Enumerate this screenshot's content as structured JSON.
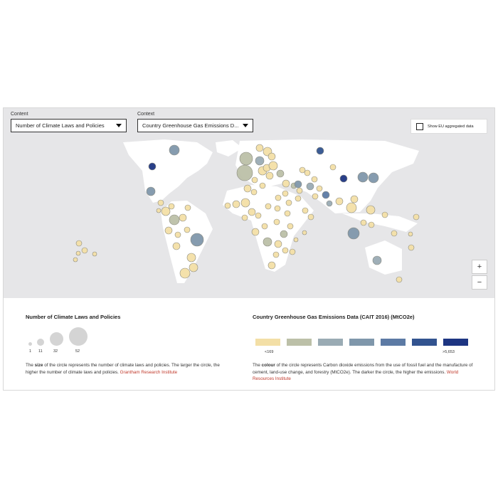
{
  "controls": {
    "content_label": "Content",
    "content_value": "Number of Climate Laws and Policies",
    "context_label": "Context",
    "context_value": "Country Greenhouse Gas Emissions D...",
    "eu_label": "Show EU aggregated data",
    "zoom_in": "+",
    "zoom_out": "−"
  },
  "size_legend": {
    "title": "Number of Climate Laws and Policies",
    "values": [
      "1",
      "11",
      "32",
      "52"
    ],
    "desc_prefix": "The ",
    "desc_bold": "size",
    "desc_rest": " of the circle represents the number of climate laws and policies. The larger the circle, the higher the number of climate laws and policies.",
    "source": "Grantham Research Institute"
  },
  "color_legend": {
    "title": "Country Greenhouse Gas Emissions Data (CAIT 2016) (MtCO2e)",
    "min_label": "<169",
    "max_label": ">5,653",
    "desc_prefix": "The ",
    "desc_bold": "colour",
    "desc_rest": " of the circle represents Carbon dioxide emissions from the use of fossil fuel and the manufacture of cement, land-use change, and forestry (MtCO2e). The darker the circle, the higher the emissions.",
    "source": "World Resources Institute"
  },
  "colors": {
    "scale": [
      "#f3dfa6",
      "#bcc0a8",
      "#9aabb4",
      "#7f97ab",
      "#5c7aa4",
      "#32538f",
      "#1d3582"
    ],
    "land": "#ffffff",
    "ocean": "#e6e6e8"
  },
  "bubbles": [
    [
      244,
      211,
      7,
      3
    ],
    [
      213,
      234,
      5,
      6
    ],
    [
      211,
      269,
      6,
      3
    ],
    [
      225,
      285,
      4,
      0
    ],
    [
      232,
      297,
      6,
      0
    ],
    [
      244,
      309,
      7,
      1
    ],
    [
      236,
      324,
      5,
      0
    ],
    [
      256,
      306,
      5,
      0
    ],
    [
      263,
      292,
      4,
      0
    ],
    [
      276,
      337,
      9,
      3
    ],
    [
      268,
      362,
      6,
      0
    ],
    [
      259,
      384,
      7,
      0
    ],
    [
      271,
      376,
      6,
      0
    ],
    [
      247,
      346,
      5,
      0
    ],
    [
      249,
      330,
      4,
      0
    ],
    [
      262,
      323,
      4,
      0
    ],
    [
      240,
      290,
      4,
      0
    ],
    [
      222,
      296,
      3,
      0
    ],
    [
      110,
      342,
      4,
      0
    ],
    [
      118,
      352,
      4,
      0
    ],
    [
      109,
      356,
      3,
      0
    ],
    [
      132,
      357,
      3,
      0
    ],
    [
      105,
      365,
      3,
      0
    ],
    [
      364,
      208,
      5,
      0
    ],
    [
      375,
      213,
      6,
      0
    ],
    [
      381,
      220,
      5,
      0
    ],
    [
      345,
      223,
      9,
      1
    ],
    [
      343,
      243,
      11,
      1
    ],
    [
      364,
      226,
      6,
      2
    ],
    [
      368,
      240,
      6,
      0
    ],
    [
      374,
      236,
      5,
      0
    ],
    [
      383,
      233,
      6,
      0
    ],
    [
      378,
      247,
      5,
      0
    ],
    [
      357,
      253,
      4,
      0
    ],
    [
      347,
      265,
      5,
      0
    ],
    [
      356,
      270,
      4,
      0
    ],
    [
      368,
      261,
      4,
      0
    ],
    [
      393,
      244,
      5,
      1
    ],
    [
      401,
      258,
      5,
      0
    ],
    [
      412,
      261,
      4,
      1
    ],
    [
      420,
      268,
      4,
      0
    ],
    [
      424,
      239,
      4,
      0
    ],
    [
      431,
      243,
      4,
      0
    ],
    [
      435,
      262,
      5,
      2
    ],
    [
      442,
      276,
      4,
      0
    ],
    [
      448,
      265,
      4,
      0
    ],
    [
      441,
      252,
      4,
      0
    ],
    [
      400,
      272,
      4,
      0
    ],
    [
      390,
      278,
      4,
      0
    ],
    [
      405,
      285,
      4,
      0
    ],
    [
      344,
      285,
      6,
      0
    ],
    [
      331,
      287,
      5,
      0
    ],
    [
      319,
      289,
      4,
      0
    ],
    [
      353,
      298,
      5,
      0
    ],
    [
      343,
      306,
      4,
      0
    ],
    [
      362,
      303,
      4,
      0
    ],
    [
      376,
      290,
      4,
      0
    ],
    [
      389,
      293,
      4,
      0
    ],
    [
      403,
      300,
      4,
      0
    ],
    [
      418,
      279,
      4,
      0
    ],
    [
      428,
      296,
      4,
      0
    ],
    [
      436,
      305,
      4,
      0
    ],
    [
      407,
      318,
      4,
      0
    ],
    [
      398,
      329,
      5,
      1
    ],
    [
      388,
      312,
      4,
      0
    ],
    [
      371,
      318,
      4,
      0
    ],
    [
      358,
      326,
      5,
      0
    ],
    [
      375,
      340,
      6,
      1
    ],
    [
      390,
      343,
      5,
      0
    ],
    [
      400,
      352,
      4,
      0
    ],
    [
      381,
      373,
      5,
      0
    ],
    [
      387,
      358,
      4,
      0
    ],
    [
      410,
      354,
      4,
      0
    ],
    [
      427,
      327,
      3,
      0
    ],
    [
      415,
      337,
      3,
      0
    ],
    [
      418,
      259,
      5,
      3
    ],
    [
      449,
      212,
      5,
      5
    ],
    [
      467,
      235,
      4,
      0
    ],
    [
      482,
      251,
      5,
      6
    ],
    [
      457,
      274,
      5,
      4
    ],
    [
      462,
      286,
      4,
      2
    ],
    [
      476,
      283,
      5,
      0
    ],
    [
      493,
      292,
      7,
      0
    ],
    [
      497,
      280,
      5,
      0
    ],
    [
      509,
      249,
      7,
      3
    ],
    [
      524,
      250,
      7,
      3
    ],
    [
      520,
      295,
      6,
      0
    ],
    [
      496,
      328,
      8,
      3
    ],
    [
      510,
      313,
      4,
      0
    ],
    [
      521,
      316,
      4,
      0
    ],
    [
      540,
      302,
      4,
      0
    ],
    [
      553,
      328,
      4,
      0
    ],
    [
      584,
      305,
      4,
      0
    ],
    [
      577,
      348,
      4,
      0
    ],
    [
      529,
      366,
      6,
      2
    ],
    [
      560,
      393,
      4,
      0
    ],
    [
      576,
      329,
      3,
      0
    ]
  ],
  "land": [
    "M172,200 L230,196 L276,200 L298,214 L290,230 L278,240 L262,250 L250,262 L237,272 L226,282 L214,285 L203,268 L199,240 L180,218 Z",
    "M240,283 L262,282 L288,300 L298,322 L284,350 L270,378 L258,398 L248,398 L238,360 L228,320 L225,298 Z",
    "M302,200 L326,197 L340,208 L320,220 L304,214 Z",
    "M336,198 L420,196 L540,198 L588,212 L580,230 L550,242 L530,264 L520,282 L505,298 L470,300 L450,284 L430,270 L408,262 L395,258 L378,262 L360,262 L340,250 L330,232 Z",
    "M318,268 L352,260 L388,262 L422,276 L440,296 L412,332 L400,372 L385,382 L372,378 L362,345 L352,310 L326,300 L312,288 Z",
    "M480,300 L520,300 L560,304 L586,314 L570,326 L540,318 L510,312 Z",
    "M512,348 L540,338 L564,350 L564,380 L540,386 L518,376 Z"
  ]
}
